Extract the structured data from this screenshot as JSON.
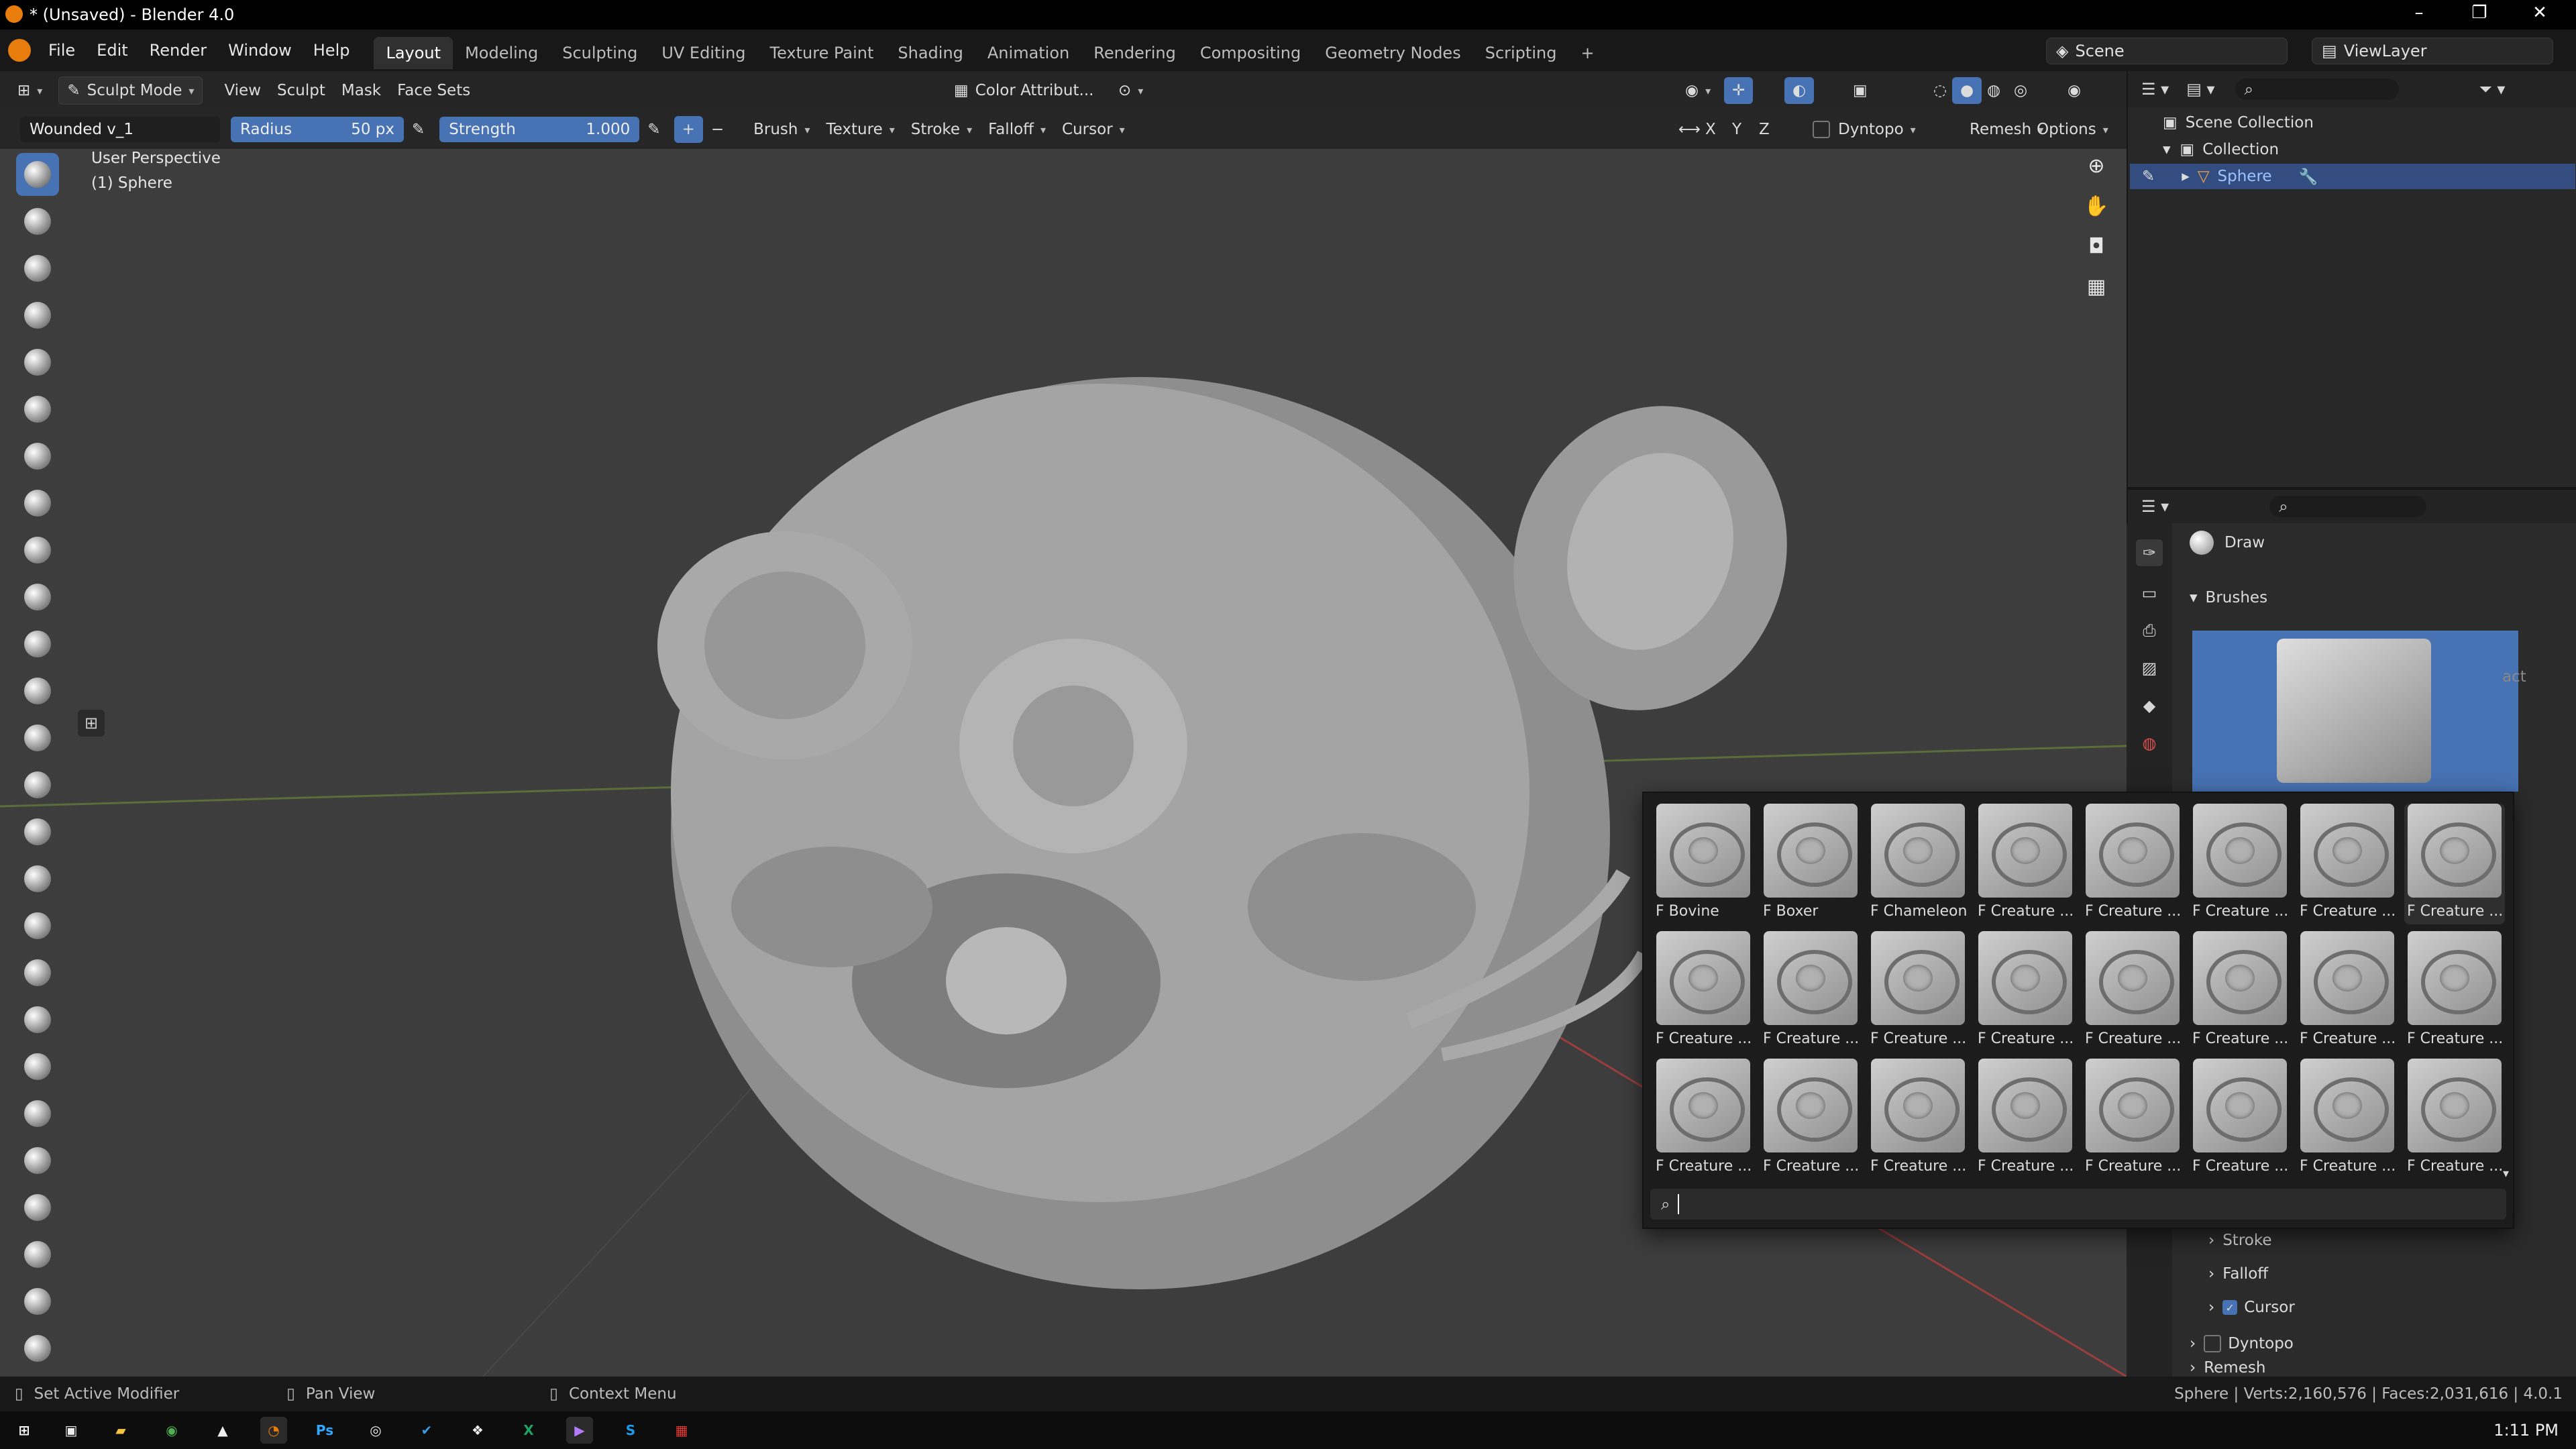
{
  "window": {
    "title": "* (Unsaved) - Blender 4.0",
    "controls": {
      "minimize": "–",
      "maximize": "❐",
      "close": "✕"
    }
  },
  "menubar": {
    "menus": [
      "File",
      "Edit",
      "Render",
      "Window",
      "Help"
    ],
    "workspaces": [
      "Layout",
      "Modeling",
      "Sculpting",
      "UV Editing",
      "Texture Paint",
      "Shading",
      "Animation",
      "Rendering",
      "Compositing",
      "Geometry Nodes",
      "Scripting"
    ],
    "active_workspace": "Layout",
    "add_tab": "+",
    "scene": "Scene",
    "view_layer": "ViewLayer"
  },
  "header": {
    "mode": "Sculpt Mode",
    "menus": [
      "View",
      "Sculpt",
      "Mask",
      "Face Sets"
    ],
    "color_attr": "Color Attribut...",
    "symmetry_axes": [
      "X",
      "Y",
      "Z"
    ],
    "dyntopo": "Dyntopo",
    "remesh": "Remesh",
    "options": "Options"
  },
  "toolsettings": {
    "brush_name": "Wounded v_1",
    "radius_label": "Radius",
    "radius_value": "50 px",
    "strength_label": "Strength",
    "strength_value": "1.000",
    "plus": "+",
    "minus": "−",
    "dropdowns": [
      "Brush",
      "Texture",
      "Stroke",
      "Falloff",
      "Cursor"
    ]
  },
  "viewport": {
    "view_name": "User Perspective",
    "object_name": "(1) Sphere"
  },
  "outliner": {
    "root": "Scene Collection",
    "collection": "Collection",
    "object": "Sphere"
  },
  "properties": {
    "tool_name": "Draw",
    "section_brushes": "Brushes",
    "sections": [
      {
        "label": "Stroke",
        "checkbox": false
      },
      {
        "label": "Falloff",
        "checkbox": false
      },
      {
        "label": "Cursor",
        "checkbox": true
      }
    ],
    "sub_sections": [
      {
        "label": "Dyntopo",
        "checkbox": true
      },
      {
        "label": "Remesh",
        "checkbox": false
      }
    ],
    "partial_text": "act"
  },
  "brush_popup": {
    "brushes": [
      "F Bovine",
      "F Boxer",
      "F Chameleon",
      "F Creature ...",
      "F Creature ...",
      "F Creature ...",
      "F Creature ...",
      "F Creature ...",
      "F Creature ...",
      "F Creature ...",
      "F Creature ...",
      "F Creature ...",
      "F Creature ...",
      "F Creature ...",
      "F Creature ...",
      "F Creature ...",
      "F Creature ...",
      "F Creature ...",
      "F Creature ...",
      "F Creature ...",
      "F Creature ...",
      "F Creature ...",
      "F Creature ...",
      "F Creature ..."
    ],
    "search_value": ""
  },
  "statusbar": {
    "hint_left": "Set Active Modifier",
    "hint_mid": "Pan View",
    "hint_right": "Context Menu",
    "stats": "Sphere | Verts:2,160,576 | Faces:2,031,616 | 4.0.1"
  },
  "taskbar": {
    "time": "1:11 PM"
  },
  "colors": {
    "accent_blue": "#4772b3",
    "viewport_bg": "#3d3d3d",
    "orange": "#e87d0d"
  }
}
